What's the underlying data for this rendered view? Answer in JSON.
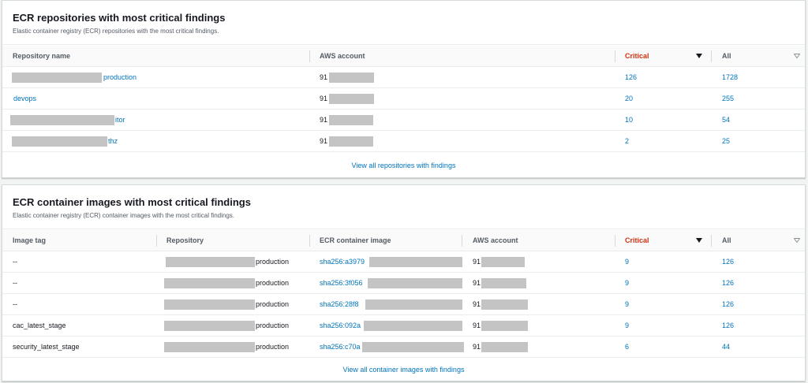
{
  "repos_panel": {
    "title": "ECR repositories with most critical findings",
    "description": "Elastic container registry (ECR) repositories with the most critical findings.",
    "columns": {
      "repository_name": "Repository name",
      "aws_account": "AWS account",
      "critical": "Critical",
      "all": "All"
    },
    "rows": [
      {
        "name_suffix": "production",
        "account_prefix": "91",
        "critical": "126",
        "all": "1728"
      },
      {
        "name_suffix": "devops",
        "account_prefix": "91",
        "critical": "20",
        "all": "255"
      },
      {
        "name_suffix": "itor",
        "account_prefix": "91",
        "critical": "10",
        "all": "54"
      },
      {
        "name_suffix": "thz",
        "account_prefix": "91",
        "critical": "2",
        "all": "25"
      }
    ],
    "footer_link": "View all repositories with findings"
  },
  "images_panel": {
    "title": "ECR container images with most critical findings",
    "description": "Elastic container registry (ECR) container images with the most critical findings.",
    "columns": {
      "image_tag": "Image tag",
      "repository": "Repository",
      "container_image": "ECR container image",
      "aws_account": "AWS account",
      "critical": "Critical",
      "all": "All"
    },
    "rows": [
      {
        "tag": "--",
        "repo_suffix": "production",
        "image_prefix": "sha256:a3979",
        "account_prefix": "91",
        "critical": "9",
        "all": "126"
      },
      {
        "tag": "--",
        "repo_suffix": "production",
        "image_prefix": "sha256:3f056",
        "account_prefix": "91",
        "critical": "9",
        "all": "126"
      },
      {
        "tag": "--",
        "repo_suffix": "production",
        "image_prefix": "sha256:28f8",
        "account_prefix": "91",
        "critical": "9",
        "all": "126"
      },
      {
        "tag": "cac_latest_stage",
        "repo_suffix": "production",
        "image_prefix": "sha256:092a",
        "account_prefix": "91",
        "critical": "9",
        "all": "126"
      },
      {
        "tag": "security_latest_stage",
        "repo_suffix": "production",
        "image_prefix": "sha256:c70a",
        "account_prefix": "91",
        "critical": "6",
        "all": "44"
      }
    ],
    "footer_link": "View all container images with findings"
  },
  "colors": {
    "link": "#0073bb",
    "critical_header": "#d13212",
    "redaction": "#c4c4c4"
  },
  "icons": {
    "sort_active": "caret-down-filled-icon",
    "sort_inactive": "caret-down-outline-icon"
  }
}
